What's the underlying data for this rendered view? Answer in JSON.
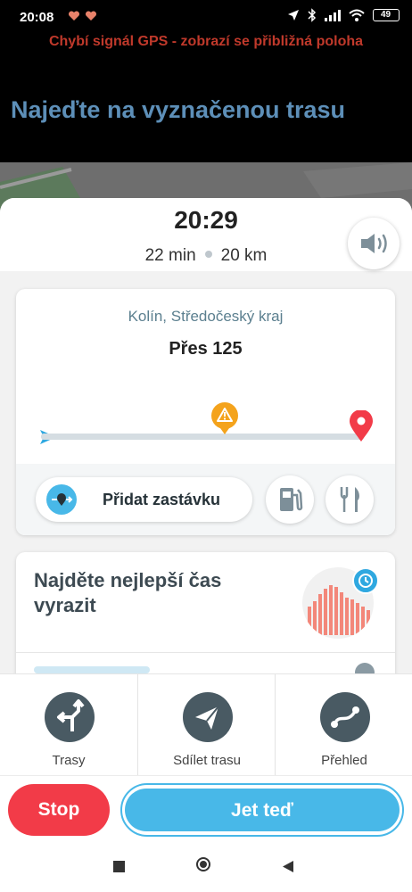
{
  "status_bar": {
    "time": "20:08",
    "battery": "49"
  },
  "gps_warning": "Chybí signál GPS - zobrazí se přibližná poloha",
  "instruction": "Najeďte na vyznačenou trasu",
  "trip": {
    "eta": "20:29",
    "duration": "22 min",
    "distance": "20 km"
  },
  "route_card": {
    "region": "Kolín, Středočeský kraj",
    "street": "Přes 125",
    "hazard_position": 0.57,
    "add_stop_label": "Přidat zastávku"
  },
  "best_time_card": {
    "title": "Najděte nejlepší čas vyrazit"
  },
  "bottom_nav": {
    "routes_label": "Trasy",
    "share_label": "Sdílet trasu",
    "overview_label": "Přehled"
  },
  "actions": {
    "stop_label": "Stop",
    "go_label": "Jet teď"
  },
  "colors": {
    "accent": "#48b8e8",
    "stop": "#f23b48",
    "warning": "#c0392b",
    "nav_icon_bg": "#495a63"
  }
}
